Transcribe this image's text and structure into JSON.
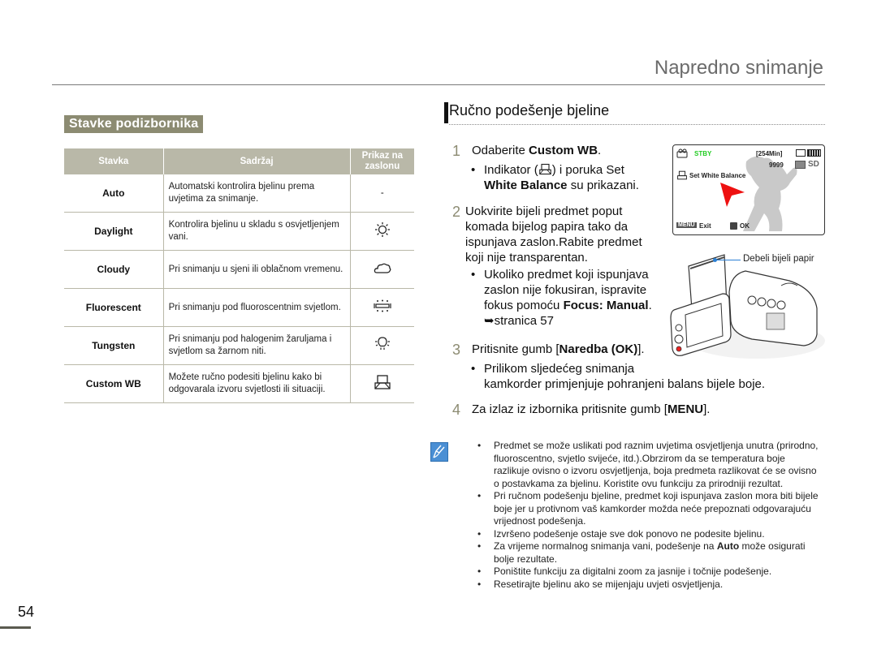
{
  "header": {
    "chapter_title": "Napredno snimanje"
  },
  "left": {
    "section_badge": "Stavke podizbornika",
    "table": {
      "columns": [
        "Stavka",
        "Sadržaj",
        "Prikaz na zaslonu"
      ],
      "rows": [
        {
          "item": "Auto",
          "desc": "Automatski kontrolira bjelinu prema uvjetima za snimanje.",
          "display": "-",
          "icon": "none"
        },
        {
          "item": "Daylight",
          "desc": "Kontrolira bjelinu u skladu s osvjetljenjem vani.",
          "display": "",
          "icon": "daylight-icon"
        },
        {
          "item": "Cloudy",
          "desc": "Pri snimanju u sjeni ili oblačnom vremenu.",
          "display": "",
          "icon": "cloudy-icon"
        },
        {
          "item": "Fluorescent",
          "desc": "Pri snimanju pod fluoroscentnim svjetlom.",
          "display": "",
          "icon": "fluorescent-icon"
        },
        {
          "item": "Tungsten",
          "desc": "Pri snimanju pod halogenim žaruljama i svjetlom sa žarnom niti.",
          "display": "",
          "icon": "tungsten-icon"
        },
        {
          "item": "Custom WB",
          "desc": "Možete ručno podesiti bjelinu kako bi odgovarala izvoru svjetlosti ili situaciji.",
          "display": "",
          "icon": "custom-wb-icon"
        }
      ]
    }
  },
  "right": {
    "section_title": "Ručno podešenje bjeline",
    "steps": [
      {
        "num": "1",
        "pre": "Odaberite ",
        "bold": "Custom WB",
        "post": "."
      },
      {
        "num": "2",
        "text": "Uokvirite bijeli predmet poput komada bijelog papira tako da ispunjava zaslon.Rabite predmet koji nije transparentan."
      },
      {
        "num": "3",
        "pre": "Pritisnite gumb [",
        "bold": "Naredba (OK)",
        "post": "]."
      },
      {
        "num": "4",
        "pre": "Za izlaz iz izbornika pritisnite gumb [",
        "bold": "MENU",
        "post": "]."
      }
    ],
    "step1_bullet": {
      "pre": "Indikator (",
      "mid": ") i poruka Set ",
      "bold": "White Balance",
      "post": " su prikazani."
    },
    "step2_bullet": {
      "pre": "Ukoliko predmet koji ispunjava zaslon nije fokusiran, ispravite fokus pomoću ",
      "bold": "Focus: Manual",
      "post": ".",
      "ref": "stranica 57"
    },
    "step3_bullet": {
      "line1": "Prilikom sljedećeg snimanja",
      "line2": "kamkorder primjenjuje pohranjeni balans bijele boje."
    },
    "lcd": {
      "status": "STBY",
      "remaining": "[254Min]",
      "count": "9999",
      "storage": "SD",
      "message": "Set White Balance",
      "menu_key": "MENU",
      "exit_label": "Exit",
      "ok_label": "OK",
      "status_color": "#22cc22",
      "arrow_color": "#ee1111"
    },
    "camera_callout": "Debeli bijeli papir"
  },
  "notes": [
    "Predmet se može uslikati pod raznim uvjetima osvjetljenja unutra (prirodno, fluoroscentno, svjetlo svijeće, itd.).Obrzirom da se temperatura boje razlikuje ovisno o izvoru osvjetljenja, boja predmeta razlikovat će se ovisno o postavkama za bjelinu. Koristite ovu funkciju za prirodniji rezultat.",
    "Pri ručnom podešenju bjeline, predmet koji ispunjava zaslon mora biti bijele boje jer u protivnom vaš kamkorder možda neće prepoznati odgovarajuću vrijednost podešenja.",
    "Izvršeno podešenje ostaje sve dok ponovo ne podesite bjelinu.",
    {
      "pre": "Za vrijeme normalnog snimanja vani, podešenje na ",
      "bold": "Auto",
      "post": " može osigurati bolje rezultate."
    },
    "Poništite funkciju za digitalni zoom za jasnije i točnije podešenje.",
    "Resetirajte bjelinu ako se mijenjaju uvjeti osvjetljenja."
  ],
  "footer": {
    "page_number": "54"
  },
  "colors": {
    "accent": "#8c8b72",
    "table_header": "#b9b8a8",
    "note_icon": "#4a8fd4"
  }
}
